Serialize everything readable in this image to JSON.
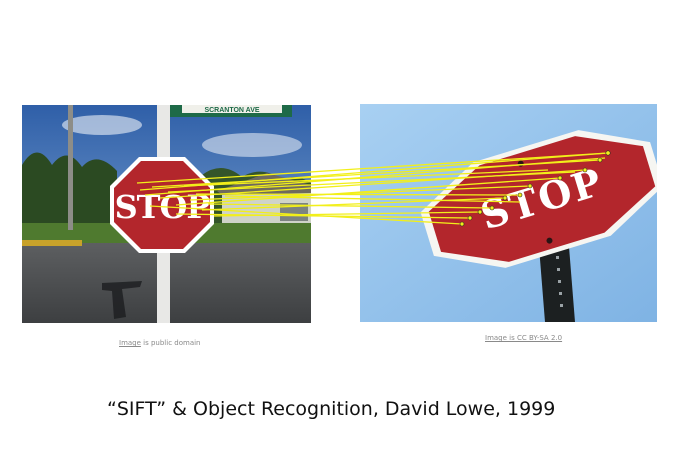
{
  "left_image": {
    "sign_text": "STOP",
    "street_sign_text": "SCRANTON AVE",
    "credit_link": "Image",
    "credit_rest": "is public domain"
  },
  "right_image": {
    "sign_text": "STOP",
    "credit": "Image is CC BY-SA 2.0"
  },
  "caption": "“SIFT” & Object Recognition, David Lowe, 1999",
  "colors": {
    "match_line": "#f2ef1a",
    "sign_red": "#b3262c",
    "sky_left": "#3f6eb4",
    "sky_right": "#8fc0ea"
  }
}
